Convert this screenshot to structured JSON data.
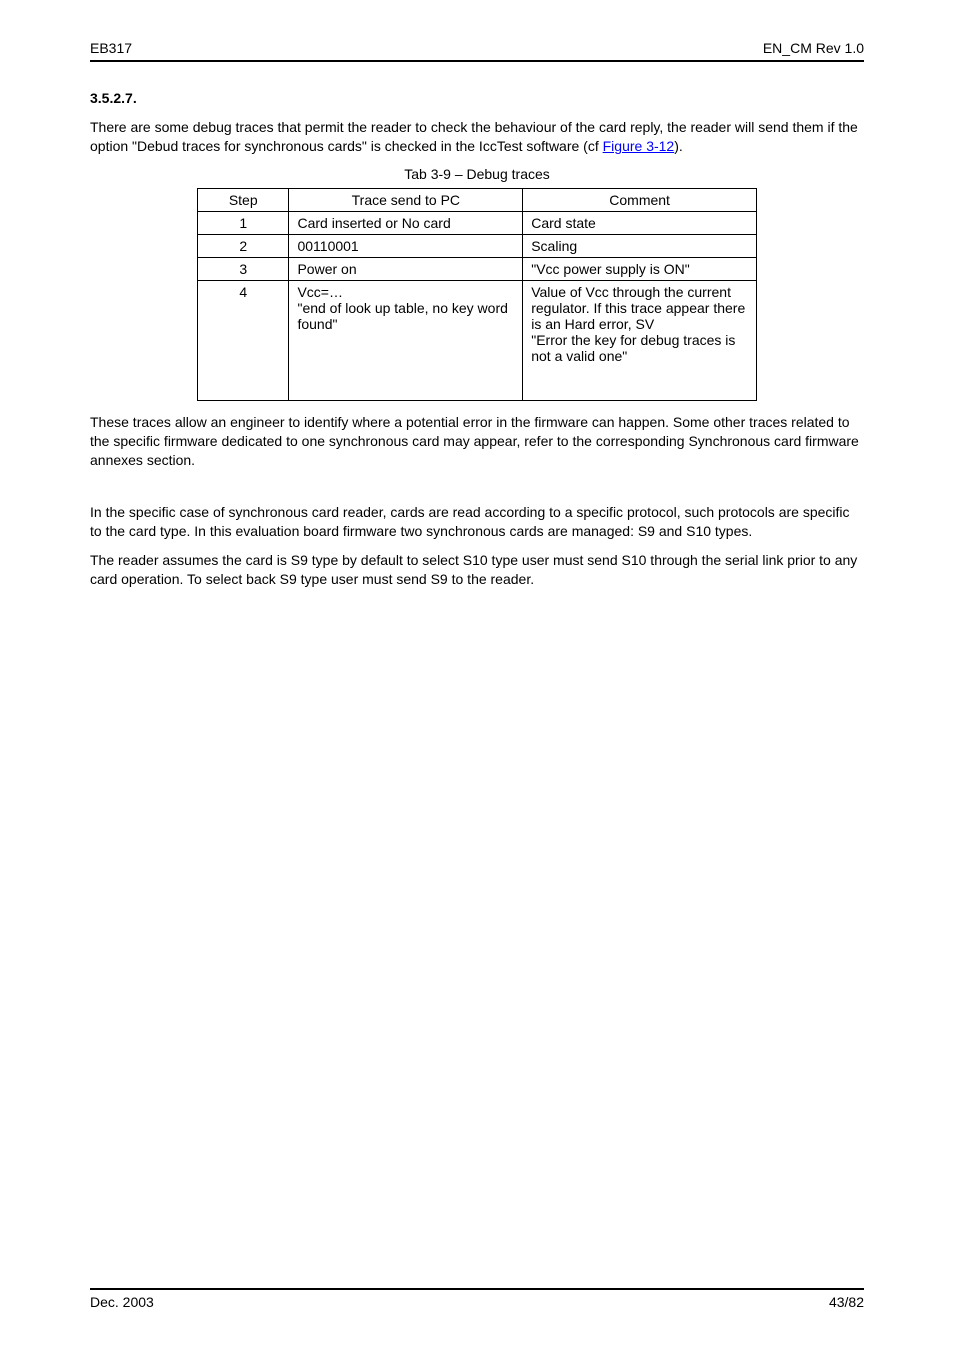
{
  "header": {
    "left": "EB317",
    "right": "EN_CM Rev 1.0"
  },
  "section_num": "3.5.2.7.",
  "intro": "There are some debug traces that permit the reader to check the behaviour of the card reply, the reader will send them if the option \"Debud traces for synchronous cards\" is checked in the IccTest software (cf Figure 3-12).",
  "tab_caption": "Tab 3-9 – Debug traces",
  "table": {
    "headers": [
      "Step",
      "Trace send to PC",
      "Comment"
    ],
    "rows": [
      {
        "c1": "1",
        "c2": "Card inserted  or  No card",
        "c3": "Card state"
      },
      {
        "c1": "2",
        "c2": "00110001",
        "c3": "Scaling"
      },
      {
        "c1": "3",
        "c2": "Power on",
        "c3": "\"Vcc power supply is ON\""
      },
      {
        "c1": "4",
        "c2": "Vcc=…\n\"end of look up table, no key word found\"",
        "c3": "Value of Vcc through the current regulator. If this trace appear there is an Hard error, SV\n\"Error the key for debug traces is not a valid one\""
      }
    ]
  },
  "para1": "These traces allow an engineer to identify where a potential error in the firmware can happen. Some other traces related to the specific firmware dedicated to one synchronous card may appear, refer to the corresponding Synchronous card firmware annexes section.",
  "para2": "In the specific case of synchronous card reader, cards are read according to a specific protocol, such protocols are specific to the card type. In this evaluation board firmware two synchronous cards are managed: S9 and S10 types.",
  "para3": "The reader assumes the card is S9 type by default to select S10 type user must send S10 through the serial link prior to any card operation. To select back S9 type user must send S9 to the reader.",
  "footer": {
    "left": "Dec. 2003",
    "right": "43/82"
  }
}
